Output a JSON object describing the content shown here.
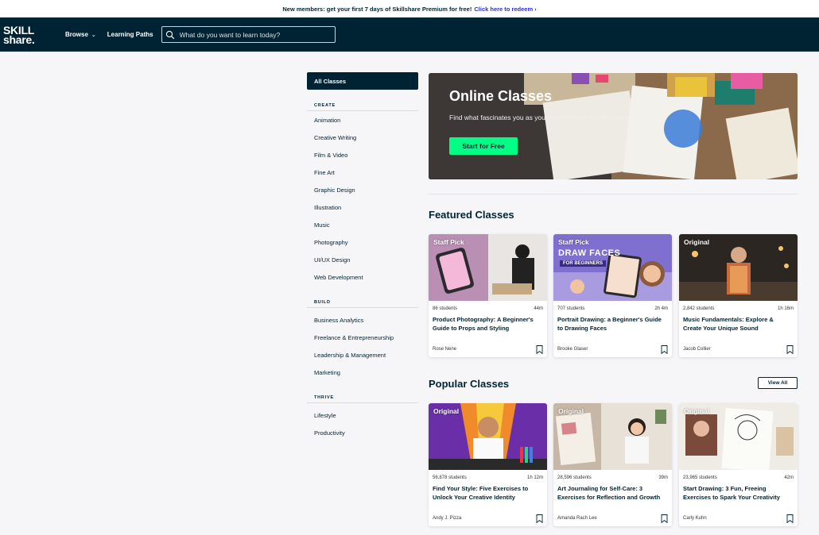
{
  "promo": {
    "text": "New members: get your first 7 days of Skillshare Premium for free!",
    "link": "Click here to redeem"
  },
  "nav": {
    "logo_top": "SKILL",
    "logo_bottom": "share.",
    "browse": "Browse",
    "learning_paths": "Learning Paths",
    "search_placeholder": "What do you want to learn today?"
  },
  "sidebar": {
    "all_classes": "All Classes",
    "groups": [
      {
        "heading": "CREATE",
        "items": [
          "Animation",
          "Creative Writing",
          "Film & Video",
          "Fine Art",
          "Graphic Design",
          "Illustration",
          "Music",
          "Photography",
          "UI/UX Design",
          "Web Development"
        ]
      },
      {
        "heading": "BUILD",
        "items": [
          "Business Analytics",
          "Freelance & Entrepreneurship",
          "Leadership & Management",
          "Marketing"
        ]
      },
      {
        "heading": "THRIVE",
        "items": [
          "Lifestyle",
          "Productivity"
        ]
      }
    ]
  },
  "hero": {
    "title": "Online Classes",
    "subtitle": "Find what fascinates you as you explore these online classes.",
    "cta": "Start for Free"
  },
  "featured": {
    "title": "Featured Classes",
    "cards": [
      {
        "badge": "Staff Pick",
        "students": "86 students",
        "duration": "44m",
        "title": "Product Photography: A Beginner's Guide to Props and Styling",
        "teacher": "Rose Nene"
      },
      {
        "badge": "Staff Pick",
        "thumb_text_1": "DRAW FACES",
        "thumb_text_2": "FOR BEGINNERS",
        "students": "707 students",
        "duration": "2h 4m",
        "title": "Portrait Drawing: a Beginner's Guide to Drawing Faces",
        "teacher": "Brooke Glaser"
      },
      {
        "badge": "Original",
        "students": "2,842 students",
        "duration": "1h 16m",
        "title": "Music Fundamentals: Explore & Create Your Unique Sound",
        "teacher": "Jacob Collier"
      }
    ]
  },
  "popular": {
    "title": "Popular Classes",
    "view_all": "View All",
    "cards": [
      {
        "badge": "Original",
        "students": "56,878 students",
        "duration": "1h 12m",
        "title": "Find Your Style: Five Exercises to Unlock Your Creative Identity",
        "teacher": "Andy J. Pizza"
      },
      {
        "badge": "Original",
        "students": "28,596 students",
        "duration": "39m",
        "title": "Art Journaling for Self-Care: 3 Exercises for Reflection and Growth",
        "teacher": "Amanda Rach Lee"
      },
      {
        "badge": "Original",
        "students": "23,965 students",
        "duration": "42m",
        "title": "Start Drawing: 3 Fun, Freeing Exercises to Spark Your Creativity",
        "teacher": "Carly Kuhn"
      }
    ]
  },
  "colors": {
    "navy": "#002333",
    "accent_green": "#00ff84",
    "link_blue": "#2e2fd4"
  },
  "icons": {
    "search": "search-icon",
    "bookmark": "bookmark-icon",
    "caret": "chevron-down-icon"
  }
}
